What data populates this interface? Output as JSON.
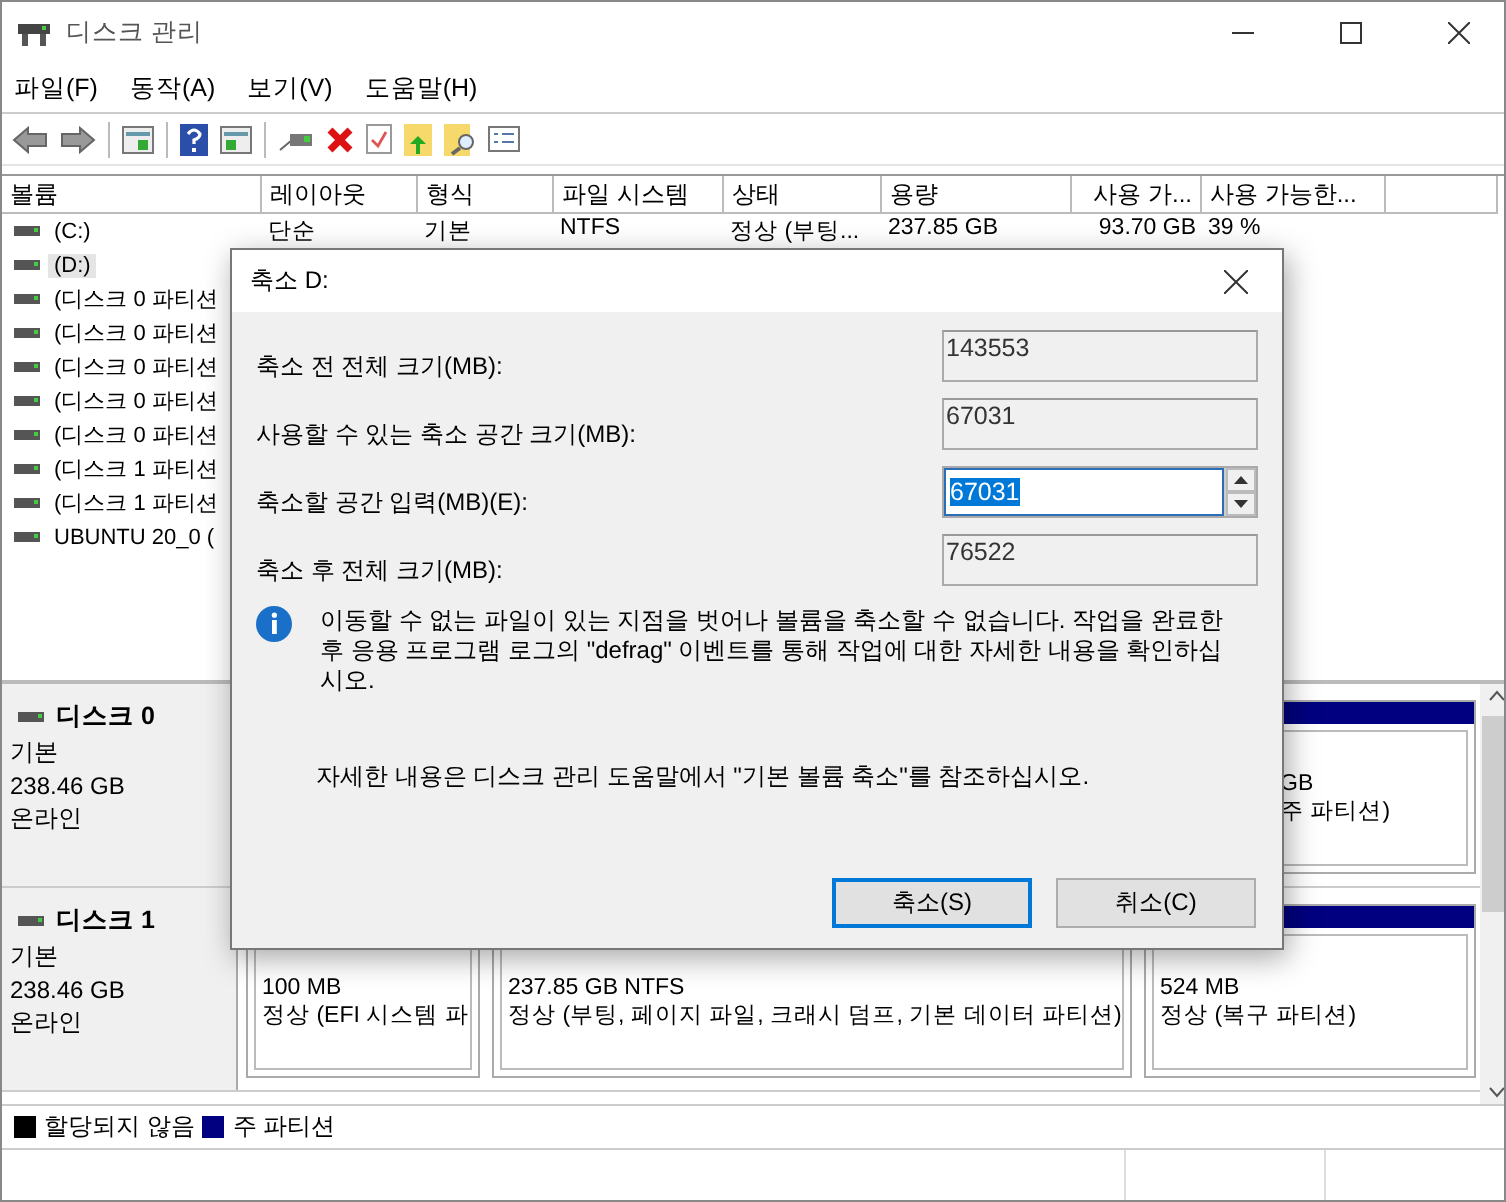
{
  "window": {
    "title": "디스크 관리"
  },
  "menu": [
    "파일(F)",
    "동작(A)",
    "보기(V)",
    "도움말(H)"
  ],
  "volume_table": {
    "columns": [
      "볼륨",
      "레이아웃",
      "형식",
      "파일 시스템",
      "상태",
      "용량",
      "사용 가...",
      "사용 가능한..."
    ],
    "rows": [
      {
        "cells": [
          "(C:)",
          "단순",
          "기본",
          "NTFS",
          "정상 (부팅...",
          "237.85 GB",
          "93.70 GB",
          "39 %"
        ],
        "selected": false
      },
      {
        "cells": [
          "(D:)"
        ],
        "selected": true
      },
      {
        "cells": [
          "(디스크 0 파티션"
        ],
        "selected": false
      },
      {
        "cells": [
          "(디스크 0 파티션"
        ],
        "selected": false
      },
      {
        "cells": [
          "(디스크 0 파티션"
        ],
        "selected": false
      },
      {
        "cells": [
          "(디스크 0 파티션"
        ],
        "selected": false
      },
      {
        "cells": [
          "(디스크 0 파티션"
        ],
        "selected": false
      },
      {
        "cells": [
          "(디스크 1 파티션"
        ],
        "selected": false
      },
      {
        "cells": [
          "(디스크 1 파티션"
        ],
        "selected": false
      },
      {
        "cells": [
          "UBUNTU 20_0 ("
        ],
        "selected": false
      }
    ]
  },
  "disks": [
    {
      "name": "디스크 0",
      "type": "기본",
      "size": "238.46 GB",
      "status": "온라인",
      "partitions": [
        {
          "size": "GB",
          "status": "주 파티션)"
        }
      ]
    },
    {
      "name": "디스크 1",
      "type": "기본",
      "size": "238.46 GB",
      "status": "온라인",
      "partitions": [
        {
          "size": "100 MB",
          "status": "정상 (EFI 시스템 파"
        },
        {
          "size": "237.85 GB NTFS",
          "status": "정상 (부팅, 페이지 파일, 크래시 덤프, 기본 데이터 파티션)"
        },
        {
          "size": "524 MB",
          "status": "정상 (복구 파티션)"
        }
      ]
    }
  ],
  "legend": [
    {
      "label": "할당되지 않음",
      "color": "#000000"
    },
    {
      "label": "주 파티션",
      "color": "#000080"
    }
  ],
  "dialog": {
    "title": "축소 D:",
    "fields": [
      {
        "kind": "readonly",
        "label": "축소 전 전체 크기(MB):",
        "value": "143553"
      },
      {
        "kind": "readonly",
        "label": "사용할 수 있는 축소 공간 크기(MB):",
        "value": "67031"
      },
      {
        "kind": "spin",
        "label": "축소할 공간 입력(MB)(E):",
        "value": "67031"
      },
      {
        "kind": "readonly",
        "label": "축소 후 전체 크기(MB):",
        "value": "76522"
      }
    ],
    "info": "이동할 수 없는 파일이 있는 지점을 벗어나 볼륨을 축소할 수 없습니다. 작업을 완료한 후 응용 프로그램 로그의 \"defrag\" 이벤트를 통해 작업에 대한 자세한 내용을 확인하십시오.",
    "help": "자세한 내용은 디스크 관리 도움말에서 \"기본 볼륨 축소\"를 참조하십시오.",
    "buttons": [
      {
        "label": "축소(S)",
        "default": true
      },
      {
        "label": "취소(C)",
        "default": false
      }
    ]
  }
}
